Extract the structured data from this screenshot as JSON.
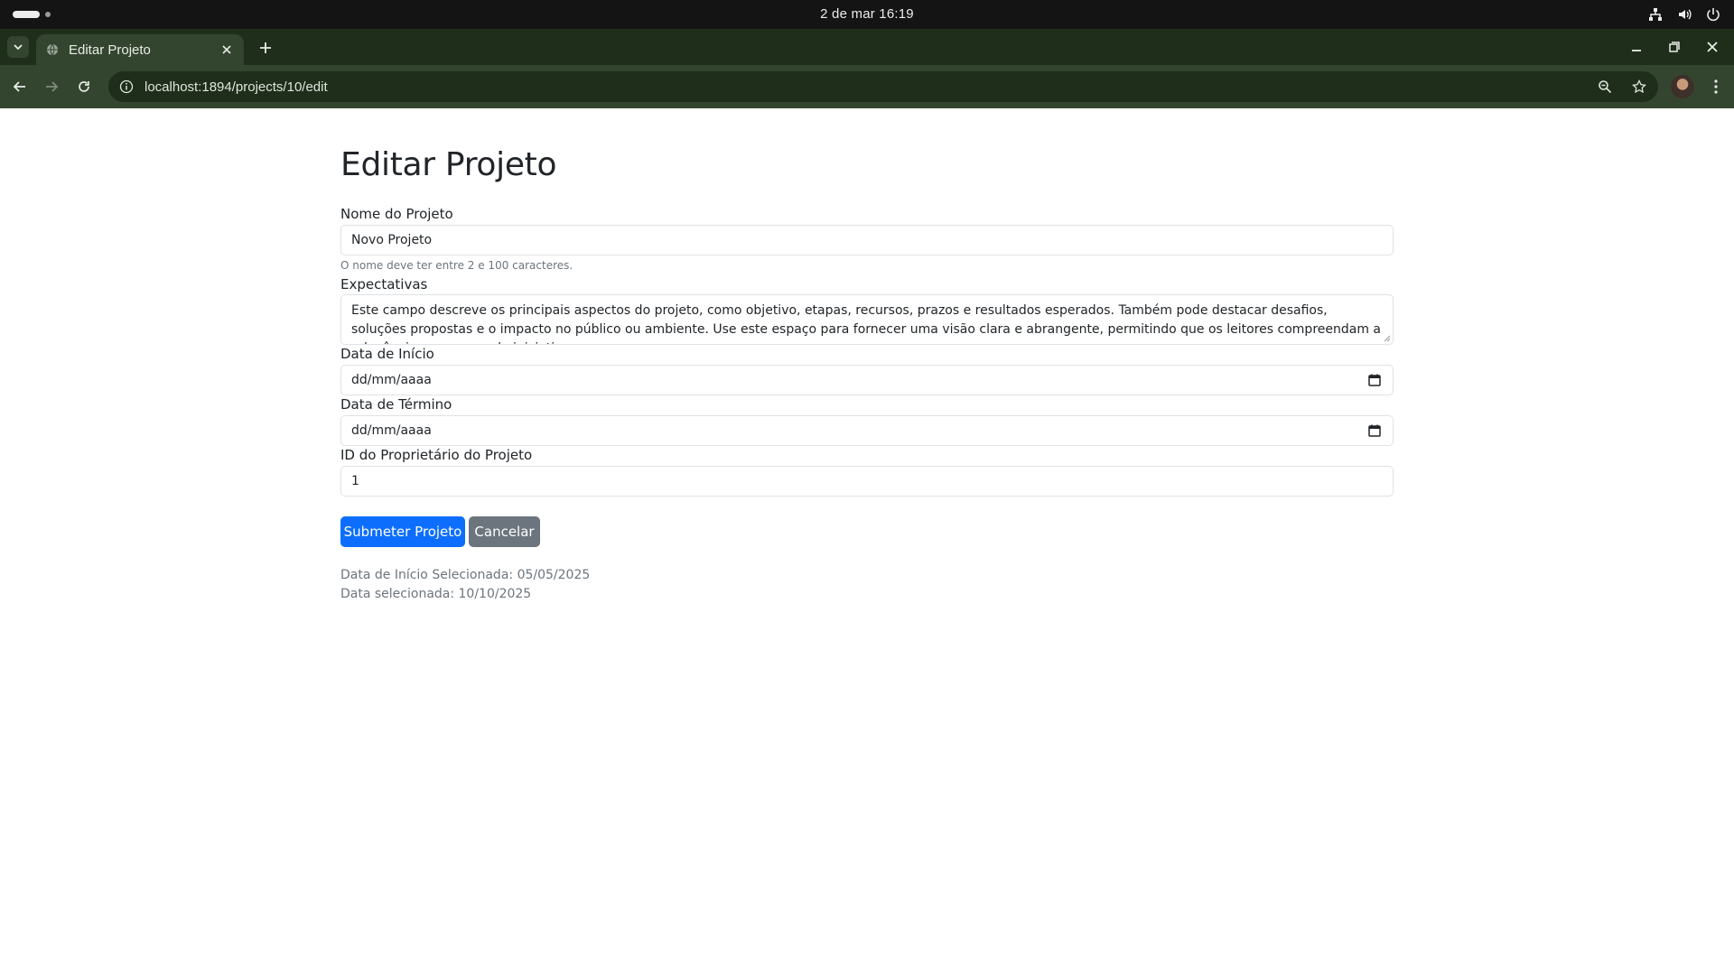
{
  "os": {
    "datetime": "2 de mar  16:19"
  },
  "browser": {
    "tab_title": "Editar Projeto",
    "url": "localhost:1894/projects/10/edit"
  },
  "page": {
    "heading": "Editar Projeto",
    "name_label": "Nome do Projeto",
    "name_value": "Novo Projeto",
    "name_hint": "O nome deve ter entre 2 e 100 caracteres.",
    "expectations_label": "Expectativas",
    "expectations_value": "Este campo descreve os principais aspectos do projeto, como objetivo, etapas, recursos, prazos e resultados esperados. Também pode destacar desafios, soluções propostas e o impacto no público ou ambiente. Use este espaço para fornecer uma visão clara e abrangente, permitindo que os leitores compreendam a relevância e o escopo da iniciativa.",
    "start_label": "Data de Início",
    "start_value": "dd/mm/aaaa",
    "end_label": "Data de Término",
    "end_value": "dd/mm/aaaa",
    "owner_label": "ID do Proprietário do Projeto",
    "owner_value": "1",
    "submit_label": "Submeter Projeto",
    "cancel_label": "Cancelar",
    "selected_start": "Data de Início Selecionada: 05/05/2025",
    "selected_date": "Data selecionada: 10/10/2025"
  },
  "colors": {
    "primary": "#0d6efd",
    "secondary": "#6c757d",
    "browser_frame": "#1f2e1b",
    "browser_toolbar": "#34452f"
  }
}
